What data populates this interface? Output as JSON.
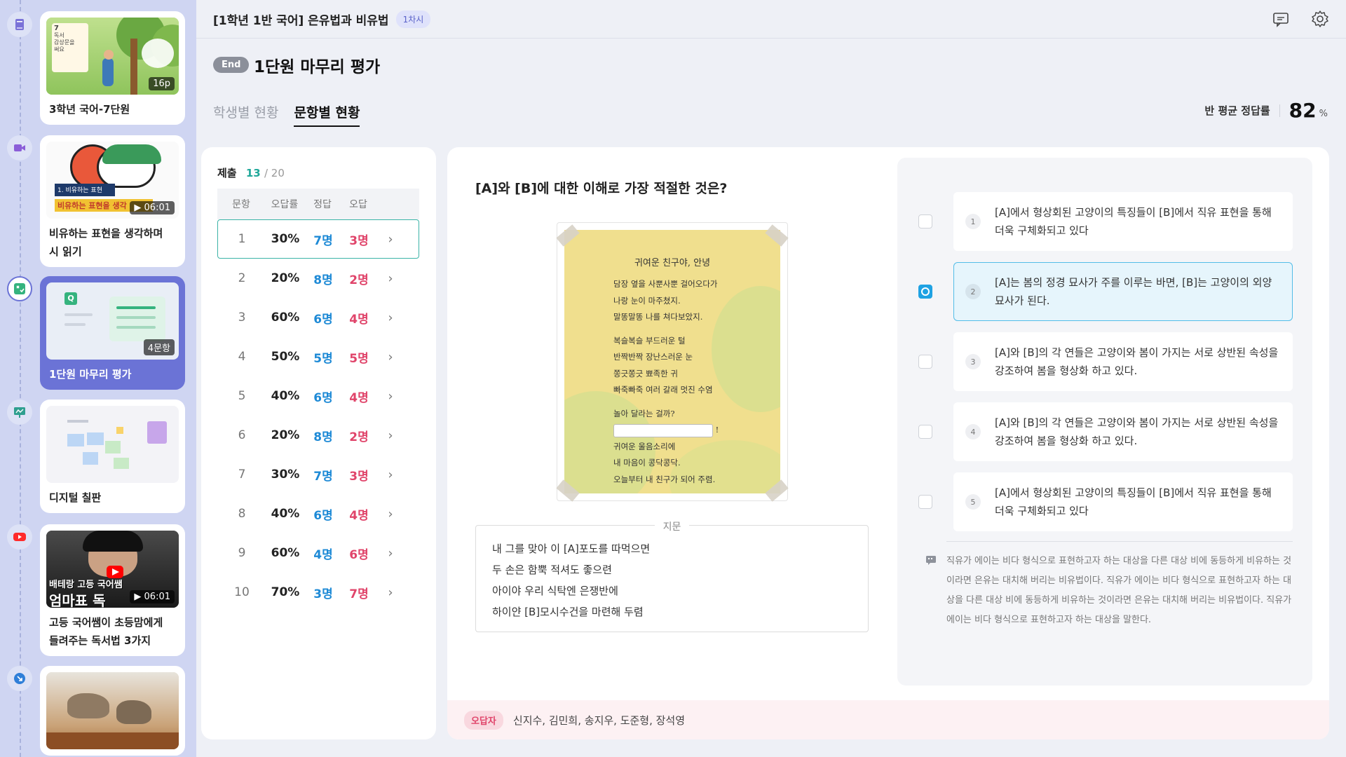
{
  "topbar": {
    "title": "[1학년 1반 국어] 은유법과 비유법",
    "session": "1차시",
    "icons": [
      "chat-icon",
      "settings-gear-icon"
    ]
  },
  "header": {
    "end_badge": "End",
    "title": "1단원 마무리 평가",
    "tabs": [
      {
        "label": "학생별 현황",
        "active": false
      },
      {
        "label": "문항별 현황",
        "active": true
      }
    ],
    "avg_label": "반 평균 정답률",
    "avg_value": "82",
    "avg_unit": "%"
  },
  "sidebar": {
    "items": [
      {
        "type": "ebook",
        "icon": "book-icon",
        "badge": "16p",
        "title": "3학년 국어-7단원",
        "active": false
      },
      {
        "type": "video",
        "icon": "video-camera-icon",
        "badge": "▶ 06:01",
        "title": "비유하는 표현을 생각하며\n시 읽기",
        "active": false
      },
      {
        "type": "quiz",
        "icon": "quiz-icon",
        "badge": "4문항",
        "title": "1단원 마무리 평가",
        "active": true
      },
      {
        "type": "board",
        "icon": "whiteboard-icon",
        "badge": "",
        "title": "디지털 칠판",
        "active": false
      },
      {
        "type": "youtube",
        "icon": "youtube-icon",
        "badge": "▶ 06:01",
        "title": "고등 국어쌤이 초등맘에게\n들려주는 독서법 3가지",
        "active": false
      },
      {
        "type": "link",
        "icon": "link-icon",
        "badge": "",
        "title": "",
        "active": false
      }
    ],
    "thumb_texts": {
      "book_number": "7",
      "book_lines": [
        "독서",
        "감상문을",
        "써요"
      ],
      "video_caption": "1. 비유하는 표현",
      "video_caption2": "비유하는 표현을 생각",
      "yt_line1": "배테랑 고등 국어쌤",
      "yt_line2": "엄마표 독"
    }
  },
  "qlist": {
    "submit_label": "제출",
    "submit_count": "13",
    "submit_total": "/ 20",
    "headers": [
      "문항",
      "오답률",
      "정답",
      "오답"
    ],
    "rows": [
      {
        "no": "1",
        "rate": "30%",
        "correct": "7명",
        "wrong": "3명",
        "active": true
      },
      {
        "no": "2",
        "rate": "20%",
        "correct": "8명",
        "wrong": "2명",
        "active": false
      },
      {
        "no": "3",
        "rate": "60%",
        "correct": "6명",
        "wrong": "4명",
        "active": false
      },
      {
        "no": "4",
        "rate": "50%",
        "correct": "5명",
        "wrong": "5명",
        "active": false
      },
      {
        "no": "5",
        "rate": "40%",
        "correct": "6명",
        "wrong": "4명",
        "active": false
      },
      {
        "no": "6",
        "rate": "20%",
        "correct": "8명",
        "wrong": "2명",
        "active": false
      },
      {
        "no": "7",
        "rate": "30%",
        "correct": "7명",
        "wrong": "3명",
        "active": false
      },
      {
        "no": "8",
        "rate": "40%",
        "correct": "6명",
        "wrong": "4명",
        "active": false
      },
      {
        "no": "9",
        "rate": "60%",
        "correct": "4명",
        "wrong": "6명",
        "active": false
      },
      {
        "no": "10",
        "rate": "70%",
        "correct": "3명",
        "wrong": "7명",
        "active": false
      }
    ]
  },
  "question": {
    "text": "[A]와 [B]에 대한 이해로 가장 적절한 것은?",
    "poem": {
      "title": "귀여운 친구야, 안녕",
      "stanza1": [
        "담장 옆을 사뿐사뿐 걸어오다가",
        "나랑 눈이 마주쳤지.",
        "말똥말똥 나를 쳐다보았지."
      ],
      "stanza2": [
        "복슬복슬 부드러운 털",
        "반짝반짝 장난스러운 눈",
        "쫑긋쫑긋 뾰족한 귀",
        "빠죽빠죽 여러 갈래 멋진 수염"
      ],
      "question_line": "놀아 달라는 걸까?",
      "blank_suffix": "!",
      "stanza3": [
        "귀여운 울음소리에",
        "내 마음이 콩닥콩닥.",
        "오늘부터 내 친구가 되어 주렴."
      ]
    },
    "passage_label": "지문",
    "passage_lines": [
      "내 그를 맞아 이 [A]포도를 따먹으면",
      "두 손은 함뿍 적셔도 좋으련",
      "아이야 우리 식탁엔 은쟁반에",
      "하이얀 [B]모시수건을 마련해 두렴"
    ],
    "options": [
      {
        "num": "1",
        "text": "[A]에서 형상회된 고양이의 특징들이 [B]에서 직유 표현을 통해 더욱 구체화되고 있다",
        "selected": false
      },
      {
        "num": "2",
        "text": "[A]는 봄의 정경 묘사가 주를 이루는 바면, [B]는 고양이의 외양 묘사가 된다.",
        "selected": true
      },
      {
        "num": "3",
        "text": "[A]와 [B]의 각 연들은 고양이와 봄이 가지는 서로 상반된 속성을 강조하여 봄을 형상화 하고 있다.",
        "selected": false
      },
      {
        "num": "4",
        "text": "[A]와 [B]의 각 연들은 고양이와 봄이 가지는 서로 상반된 속성을 강조하여 봄을 형상화 하고 있다.",
        "selected": false
      },
      {
        "num": "5",
        "text": "[A]에서 형상회된 고양이의 특징들이 [B]에서 직유 표현을 통해 더욱 구체화되고 있다",
        "selected": false
      }
    ],
    "explanation": "직유가 에이는 비다 형식으로 표현하고자 하는 대상을 다른 대상 비에 동등하게 비유하는 것이라면 은유는 대치해 버리는 비유법이다. 직유가 에이는 비다 형식으로 표현하고자 하는 대상을 다른 대상 비에 동등하게 비유하는 것이라면 은유는 대치해 버리는 비유법이다. 직유가 에이는 비다 형식으로 표현하고자 하는 대상을 말한다.",
    "wrong_label": "오답자",
    "wrong_names": "신지수, 김민희, 송지우, 도준형, 장석영"
  },
  "colors": {
    "accent": "#6b73d6",
    "teal": "#20a89a",
    "correct_blue": "#1e8ad6",
    "wrong_pink": "#e0446a",
    "sidebar_bg": "#cfd5f2"
  }
}
